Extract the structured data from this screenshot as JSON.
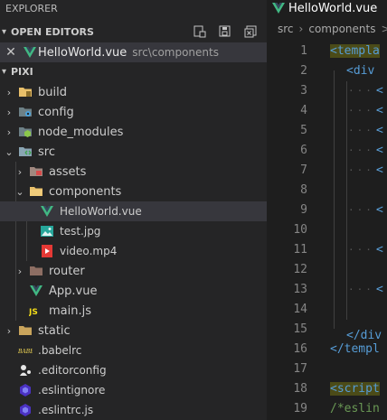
{
  "sidebar": {
    "title": "EXPLORER",
    "open_editors": {
      "header": "OPEN EDITORS",
      "actions": [
        "new-file-icon",
        "save-all-icon",
        "close-all-icon"
      ],
      "items": [
        {
          "name": "HelloWorld.vue",
          "path": "src\\components"
        }
      ]
    },
    "project": {
      "header": "PIXI",
      "items": [
        {
          "label": "build",
          "type": "folder",
          "expanded": false,
          "icon": "build-folder-icon"
        },
        {
          "label": "config",
          "type": "folder",
          "expanded": false,
          "icon": "config-folder-icon"
        },
        {
          "label": "node_modules",
          "type": "folder",
          "expanded": false,
          "icon": "node-folder-icon"
        },
        {
          "label": "src",
          "type": "folder",
          "expanded": true,
          "icon": "src-folder-icon"
        },
        {
          "label": "assets",
          "type": "folder",
          "expanded": false,
          "icon": "assets-folder-icon"
        },
        {
          "label": "components",
          "type": "folder",
          "expanded": true,
          "icon": "components-folder-icon"
        },
        {
          "label": "HelloWorld.vue",
          "type": "file",
          "icon": "vue-file-icon",
          "selected": true
        },
        {
          "label": "test.jpg",
          "type": "file",
          "icon": "image-file-icon"
        },
        {
          "label": "video.mp4",
          "type": "file",
          "icon": "video-file-icon"
        },
        {
          "label": "router",
          "type": "folder",
          "expanded": false,
          "icon": "router-folder-icon"
        },
        {
          "label": "App.vue",
          "type": "file",
          "icon": "vue-file-icon"
        },
        {
          "label": "main.js",
          "type": "file",
          "icon": "js-file-icon"
        },
        {
          "label": "static",
          "type": "folder",
          "expanded": false,
          "icon": "static-folder-icon"
        },
        {
          "label": ".babelrc",
          "type": "file",
          "icon": "babel-file-icon"
        },
        {
          "label": ".editorconfig",
          "type": "file",
          "icon": "editorconfig-file-icon"
        },
        {
          "label": ".eslintignore",
          "type": "file",
          "icon": "eslint-file-icon"
        },
        {
          "label": ".eslintrc.js",
          "type": "file",
          "icon": "eslint-file-icon"
        }
      ]
    }
  },
  "editor": {
    "tab": {
      "label": "HelloWorld.vue"
    },
    "breadcrumb": [
      "src",
      "components",
      ">"
    ],
    "lines": [
      {
        "n": "1",
        "text": "<templa"
      },
      {
        "n": "2",
        "text": "<div"
      },
      {
        "n": "3",
        "text": "<"
      },
      {
        "n": "4",
        "text": "<"
      },
      {
        "n": "5",
        "text": "<"
      },
      {
        "n": "6",
        "text": "<"
      },
      {
        "n": "7",
        "text": "<"
      },
      {
        "n": "8",
        "text": ""
      },
      {
        "n": "9",
        "text": "<"
      },
      {
        "n": "10",
        "text": ""
      },
      {
        "n": "11",
        "text": "<"
      },
      {
        "n": "12",
        "text": ""
      },
      {
        "n": "13",
        "text": "<"
      },
      {
        "n": "14",
        "text": ""
      },
      {
        "n": "15",
        "text": ""
      },
      {
        "n": "16",
        "text": "</div"
      },
      {
        "n": "17",
        "text": "</templ"
      },
      {
        "n": "18",
        "text": ""
      },
      {
        "n": "19",
        "text": "<script"
      },
      {
        "n": "20",
        "text": "/*eslin"
      }
    ]
  },
  "colors": {
    "sidebar_bg": "#252526",
    "editor_bg": "#1e1e1e",
    "selected_row": "#37373d",
    "tag_blue": "#569cd6",
    "comment_green": "#6a9955"
  }
}
